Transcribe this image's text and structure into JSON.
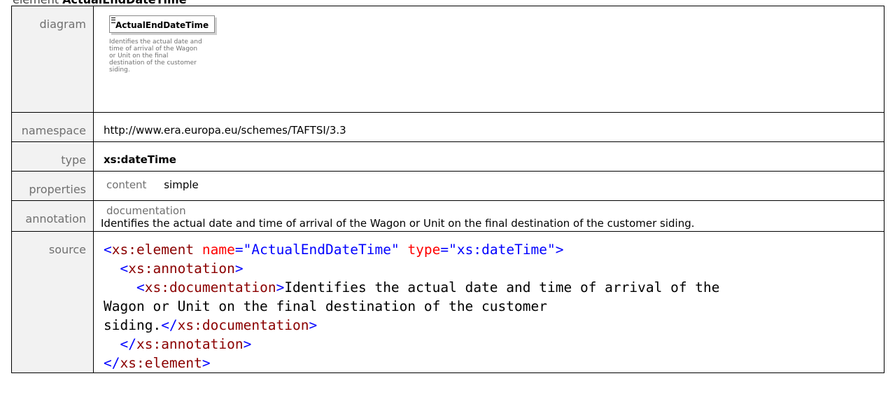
{
  "heading": {
    "kind": "element",
    "name": "ActualEndDateTime"
  },
  "rows": {
    "diagram": {
      "label": "diagram",
      "box_title": "ActualEndDateTime",
      "doc_lines": [
        "Identifies the actual date and",
        "time of arrival of the Wagon",
        "or Unit on the final",
        "destination of the customer",
        "siding."
      ]
    },
    "namespace": {
      "label": "namespace",
      "value": "http://www.era.europa.eu/schemes/TAFTSI/3.3"
    },
    "type": {
      "label": "type",
      "value": "xs:dateTime"
    },
    "properties": {
      "label": "properties",
      "key": "content",
      "value": "simple"
    },
    "annotation": {
      "label": "annotation",
      "key": "documentation",
      "value": "Identifies the actual date and time of arrival of the Wagon or Unit on the final destination of the customer siding."
    },
    "source": {
      "label": "source",
      "open_el": "xs:element",
      "attr1_name": "name",
      "attr1_val": "\"ActualEndDateTime\"",
      "attr2_name": "type",
      "attr2_val": "\"xs:dateTime\"",
      "annotation_tag": "xs:annotation",
      "documentation_tag": "xs:documentation",
      "doc_text_1": "Identifies the actual date and time of arrival of the",
      "doc_text_2": "Wagon or Unit on the final destination of the customer",
      "doc_text_3": "siding."
    }
  },
  "colors": {
    "tag": "#0000ff",
    "tag_name": "#8b0000",
    "attr_name": "#ff0000",
    "attr_value": "#0000ff",
    "label_bg": "#f2f2f2",
    "label_text": "#707070"
  }
}
